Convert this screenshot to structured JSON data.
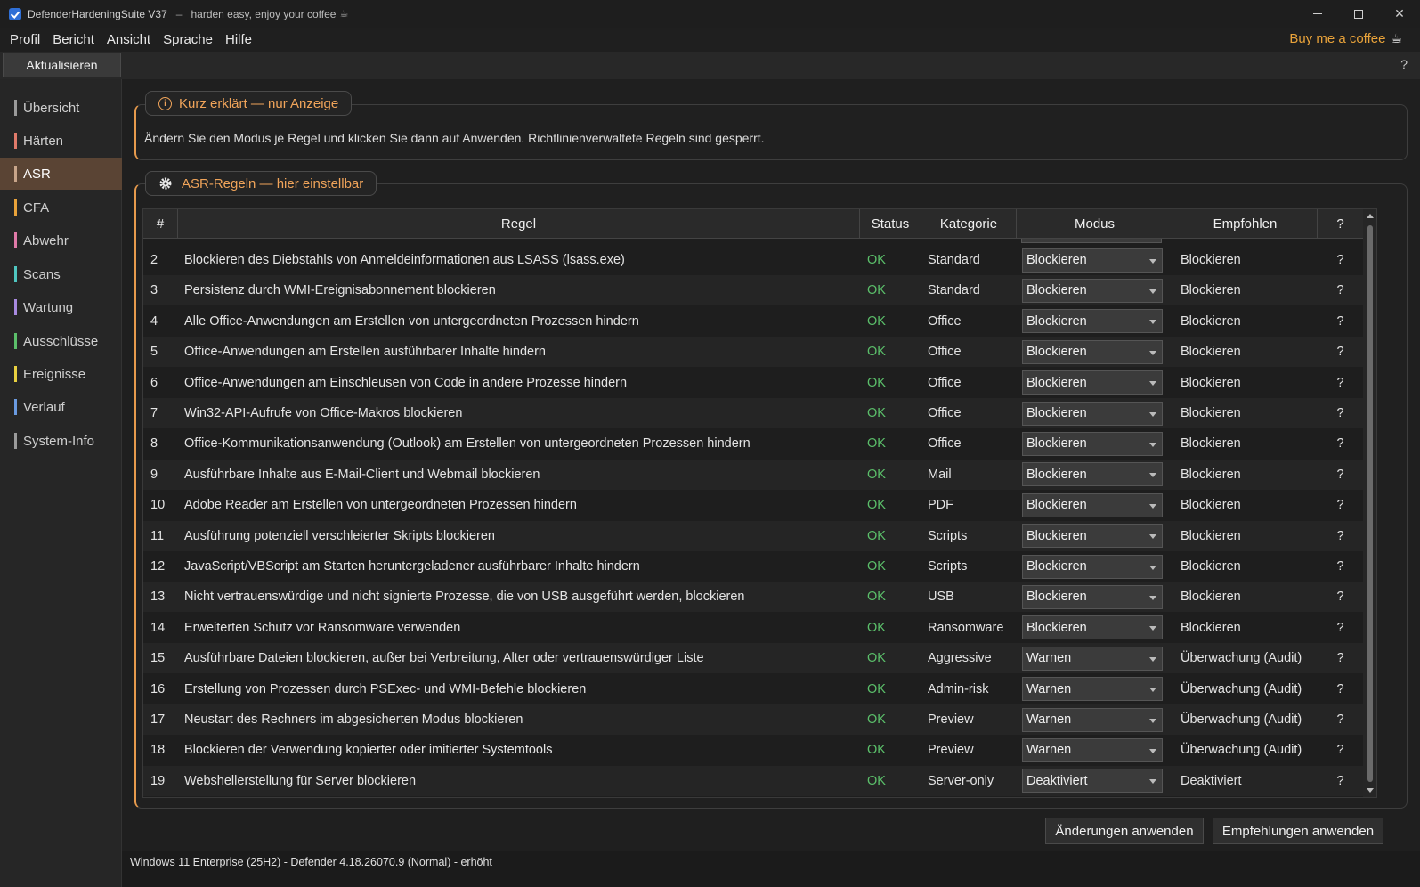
{
  "window": {
    "title": "DefenderHardeningSuite V37",
    "separator": "–",
    "subtitle": "harden easy, enjoy your coffee",
    "controls": [
      "minimize",
      "maximize",
      "close"
    ]
  },
  "menu": {
    "items": [
      {
        "first": "P",
        "rest": "rofil"
      },
      {
        "first": "B",
        "rest": "ericht"
      },
      {
        "first": "A",
        "rest": "nsicht"
      },
      {
        "first": "S",
        "rest": "prache"
      },
      {
        "first": "H",
        "rest": "ilfe"
      }
    ],
    "coffee_label": "Buy me a coffee"
  },
  "toolbar": {
    "refresh_label": "Aktualisieren",
    "help": "?"
  },
  "sidebar": {
    "items": [
      {
        "label": "Übersicht",
        "color": "#9a9a9a"
      },
      {
        "label": "Härten",
        "color": "#e07a6a"
      },
      {
        "label": "ASR",
        "color": "#c8a58a",
        "active": true
      },
      {
        "label": "CFA",
        "color": "#e8a23a"
      },
      {
        "label": "Abwehr",
        "color": "#e07aa8"
      },
      {
        "label": "Scans",
        "color": "#4fc6c0"
      },
      {
        "label": "Wartung",
        "color": "#a88ae0"
      },
      {
        "label": "Ausschlüsse",
        "color": "#5bbf6a"
      },
      {
        "label": "Ereignisse",
        "color": "#e8d040"
      },
      {
        "label": "Verlauf",
        "color": "#6a9ae0"
      },
      {
        "label": "System-Info",
        "color": "#9a9a9a"
      }
    ]
  },
  "info": {
    "title": "Kurz erklärt — nur Anzeige",
    "text": "Ändern Sie den Modus je Regel und klicken Sie dann auf Anwenden. Richtlinienverwaltete Regeln sind gesperrt."
  },
  "asr": {
    "title": "ASR-Regeln — hier einstellbar",
    "columns": [
      "#",
      "Regel",
      "Status",
      "Kategorie",
      "Modus",
      "Empfohlen",
      "?"
    ],
    "rows": [
      {
        "num": "2",
        "rule": "Blockieren des Diebstahls von Anmeldeinformationen aus LSASS (lsass.exe)",
        "status": "OK",
        "category": "Standard",
        "mode": "Blockieren",
        "recommended": "Blockieren",
        "help": "?"
      },
      {
        "num": "3",
        "rule": "Persistenz durch WMI-Ereignisabonnement blockieren",
        "status": "OK",
        "category": "Standard",
        "mode": "Blockieren",
        "recommended": "Blockieren",
        "help": "?"
      },
      {
        "num": "4",
        "rule": "Alle Office-Anwendungen am Erstellen von untergeordneten Prozessen hindern",
        "status": "OK",
        "category": "Office",
        "mode": "Blockieren",
        "recommended": "Blockieren",
        "help": "?"
      },
      {
        "num": "5",
        "rule": "Office-Anwendungen am Erstellen ausführbarer Inhalte hindern",
        "status": "OK",
        "category": "Office",
        "mode": "Blockieren",
        "recommended": "Blockieren",
        "help": "?"
      },
      {
        "num": "6",
        "rule": "Office-Anwendungen am Einschleusen von Code in andere Prozesse hindern",
        "status": "OK",
        "category": "Office",
        "mode": "Blockieren",
        "recommended": "Blockieren",
        "help": "?"
      },
      {
        "num": "7",
        "rule": "Win32-API-Aufrufe von Office-Makros blockieren",
        "status": "OK",
        "category": "Office",
        "mode": "Blockieren",
        "recommended": "Blockieren",
        "help": "?"
      },
      {
        "num": "8",
        "rule": "Office-Kommunikationsanwendung (Outlook) am Erstellen von untergeordneten Prozessen hindern",
        "status": "OK",
        "category": "Office",
        "mode": "Blockieren",
        "recommended": "Blockieren",
        "help": "?"
      },
      {
        "num": "9",
        "rule": "Ausführbare Inhalte aus E-Mail-Client und Webmail blockieren",
        "status": "OK",
        "category": "Mail",
        "mode": "Blockieren",
        "recommended": "Blockieren",
        "help": "?"
      },
      {
        "num": "10",
        "rule": "Adobe Reader am Erstellen von untergeordneten Prozessen hindern",
        "status": "OK",
        "category": "PDF",
        "mode": "Blockieren",
        "recommended": "Blockieren",
        "help": "?"
      },
      {
        "num": "11",
        "rule": "Ausführung potenziell verschleierter Skripts blockieren",
        "status": "OK",
        "category": "Scripts",
        "mode": "Blockieren",
        "recommended": "Blockieren",
        "help": "?"
      },
      {
        "num": "12",
        "rule": "JavaScript/VBScript am Starten heruntergeladener ausführbarer Inhalte hindern",
        "status": "OK",
        "category": "Scripts",
        "mode": "Blockieren",
        "recommended": "Blockieren",
        "help": "?"
      },
      {
        "num": "13",
        "rule": "Nicht vertrauenswürdige und nicht signierte Prozesse, die von USB ausgeführt werden, blockieren",
        "status": "OK",
        "category": "USB",
        "mode": "Blockieren",
        "recommended": "Blockieren",
        "help": "?"
      },
      {
        "num": "14",
        "rule": "Erweiterten Schutz vor Ransomware verwenden",
        "status": "OK",
        "category": "Ransomware",
        "mode": "Blockieren",
        "recommended": "Blockieren",
        "help": "?"
      },
      {
        "num": "15",
        "rule": "Ausführbare Dateien blockieren, außer bei Verbreitung, Alter oder vertrauenswürdiger Liste",
        "status": "OK",
        "category": "Aggressive",
        "mode": "Warnen",
        "recommended": "Überwachung (Audit)",
        "help": "?"
      },
      {
        "num": "16",
        "rule": "Erstellung von Prozessen durch PSExec- und WMI-Befehle blockieren",
        "status": "OK",
        "category": "Admin-risk",
        "mode": "Warnen",
        "recommended": "Überwachung (Audit)",
        "help": "?"
      },
      {
        "num": "17",
        "rule": "Neustart des Rechners im abgesicherten Modus blockieren",
        "status": "OK",
        "category": "Preview",
        "mode": "Warnen",
        "recommended": "Überwachung (Audit)",
        "help": "?"
      },
      {
        "num": "18",
        "rule": "Blockieren der Verwendung kopierter oder imitierter Systemtools",
        "status": "OK",
        "category": "Preview",
        "mode": "Warnen",
        "recommended": "Überwachung (Audit)",
        "help": "?"
      },
      {
        "num": "19",
        "rule": "Webshellerstellung für Server blockieren",
        "status": "OK",
        "category": "Server-only",
        "mode": "Deaktiviert",
        "recommended": "Deaktiviert",
        "help": "?"
      }
    ]
  },
  "actions": {
    "apply_changes": "Änderungen anwenden",
    "apply_recommendations": "Empfehlungen anwenden"
  },
  "statusbar": {
    "text": "Windows 11 Enterprise (25H2) - Defender 4.18.26070.9 (Normal) - erhöht"
  },
  "colors": {
    "accent": "#e69a4d",
    "ok": "#5bbf6a",
    "active_nav": "#5a4434"
  }
}
